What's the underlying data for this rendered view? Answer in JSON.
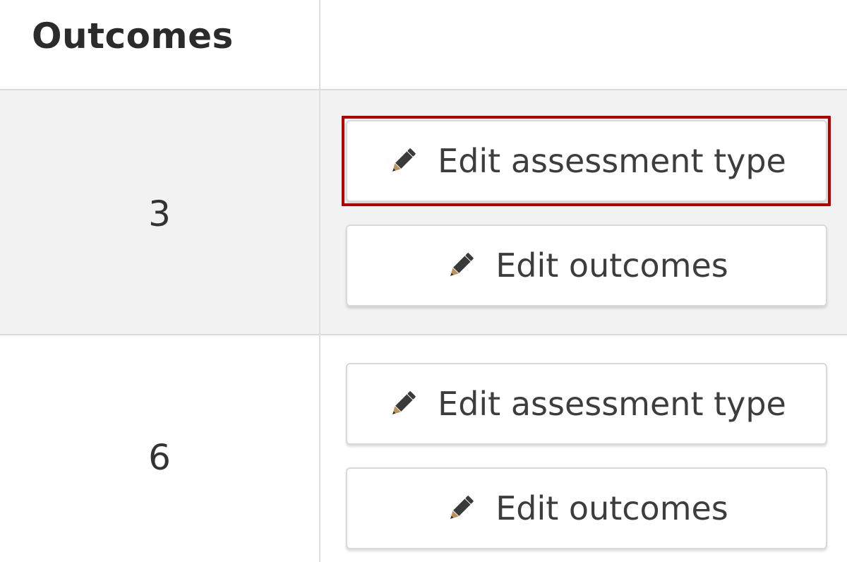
{
  "header": {
    "title": "Outcomes"
  },
  "rows": [
    {
      "count": "3",
      "edit_assessment_type_label": "Edit assessment type",
      "edit_outcomes_label": "Edit outcomes"
    },
    {
      "count": "6",
      "edit_assessment_type_label": "Edit assessment type",
      "edit_outcomes_label": "Edit outcomes"
    }
  ],
  "icons": {
    "edit": "pencil-icon"
  },
  "colors": {
    "highlight_border": "#b30000",
    "row_shaded_bg": "#f2f2f2"
  }
}
